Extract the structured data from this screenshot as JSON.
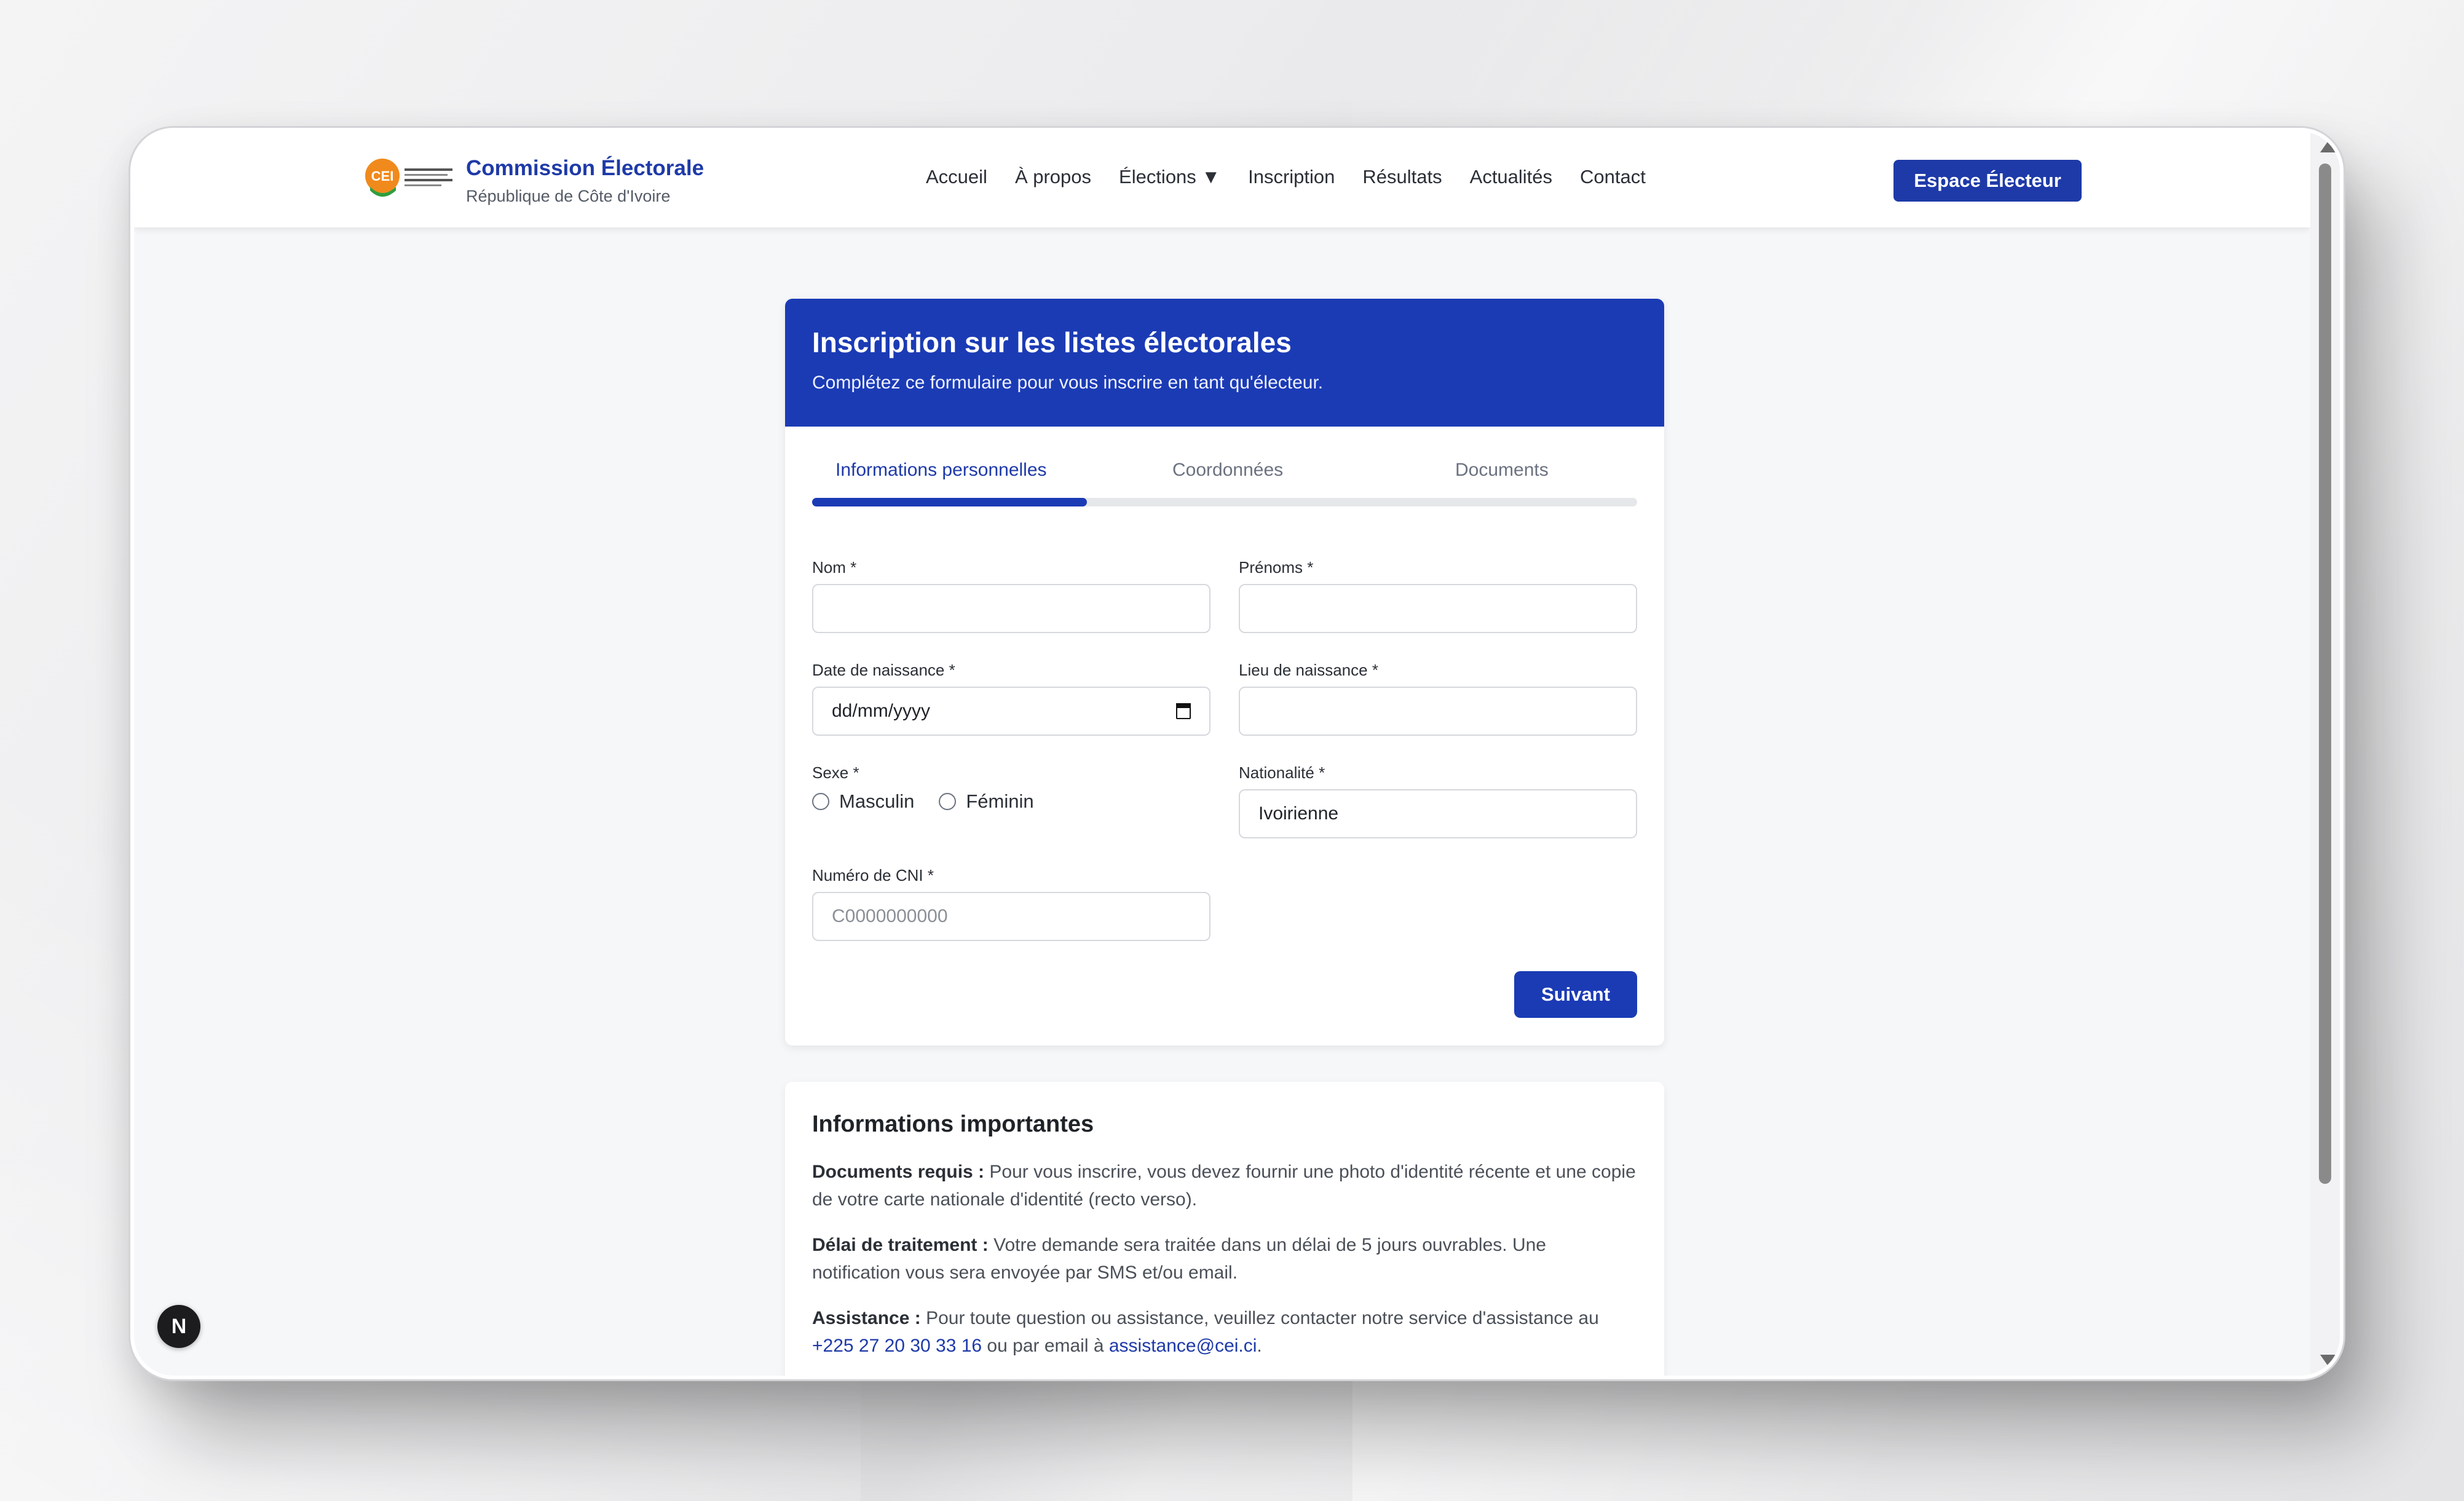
{
  "brand": {
    "logo_text": "CEI",
    "title": "Commission Électorale",
    "subtitle": "République de Côte d'Ivoire"
  },
  "nav": {
    "links": [
      "Accueil",
      "À propos",
      "Élections ▼",
      "Inscription",
      "Résultats",
      "Actualités",
      "Contact"
    ],
    "cta": "Espace Électeur"
  },
  "form": {
    "title": "Inscription sur les listes électorales",
    "subtitle": "Complétez ce formulaire pour vous inscrire en tant qu'électeur.",
    "tabs": [
      {
        "label": "Informations personnelles",
        "active": true
      },
      {
        "label": "Coordonnées",
        "active": false
      },
      {
        "label": "Documents",
        "active": false
      }
    ],
    "progress_fraction": 0.3333,
    "fields": {
      "nom": {
        "label": "Nom *",
        "value": ""
      },
      "prenoms": {
        "label": "Prénoms *",
        "value": ""
      },
      "date_naissance": {
        "label": "Date de naissance *",
        "value": "dd/mm/yyyy"
      },
      "lieu_naissance": {
        "label": "Lieu de naissance *",
        "value": ""
      },
      "sexe": {
        "label": "Sexe *",
        "options": [
          "Masculin",
          "Féminin"
        ]
      },
      "nationalite": {
        "label": "Nationalité *",
        "value": "Ivoirienne"
      },
      "cni": {
        "label": "Numéro de CNI *",
        "value": "",
        "placeholder": "C0000000000"
      }
    },
    "next_button": "Suivant"
  },
  "info": {
    "title": "Informations importantes",
    "documents": {
      "heading": "Documents requis :",
      "text": " Pour vous inscrire, vous devez fournir une photo d'identité récente et une copie de votre carte nationale d'identité (recto verso)."
    },
    "delai": {
      "heading": "Délai de traitement :",
      "text": " Votre demande sera traitée dans un délai de 5 jours ouvrables. Une notification vous sera envoyée par SMS et/ou email."
    },
    "assistance": {
      "heading": "Assistance :",
      "text_before": " Pour toute question ou assistance, veuillez contacter notre service d'assistance au ",
      "phone": "+225 27 20 30 33 16",
      "text_middle": " ou par email à ",
      "email": "assistance@cei.ci",
      "text_after": "."
    }
  },
  "badge_letter": "N",
  "colors": {
    "primary": "#1b3bb5",
    "brand_text": "#1e3aa8",
    "logo_orange": "#f08a1c",
    "logo_green": "#2e9e3e"
  }
}
